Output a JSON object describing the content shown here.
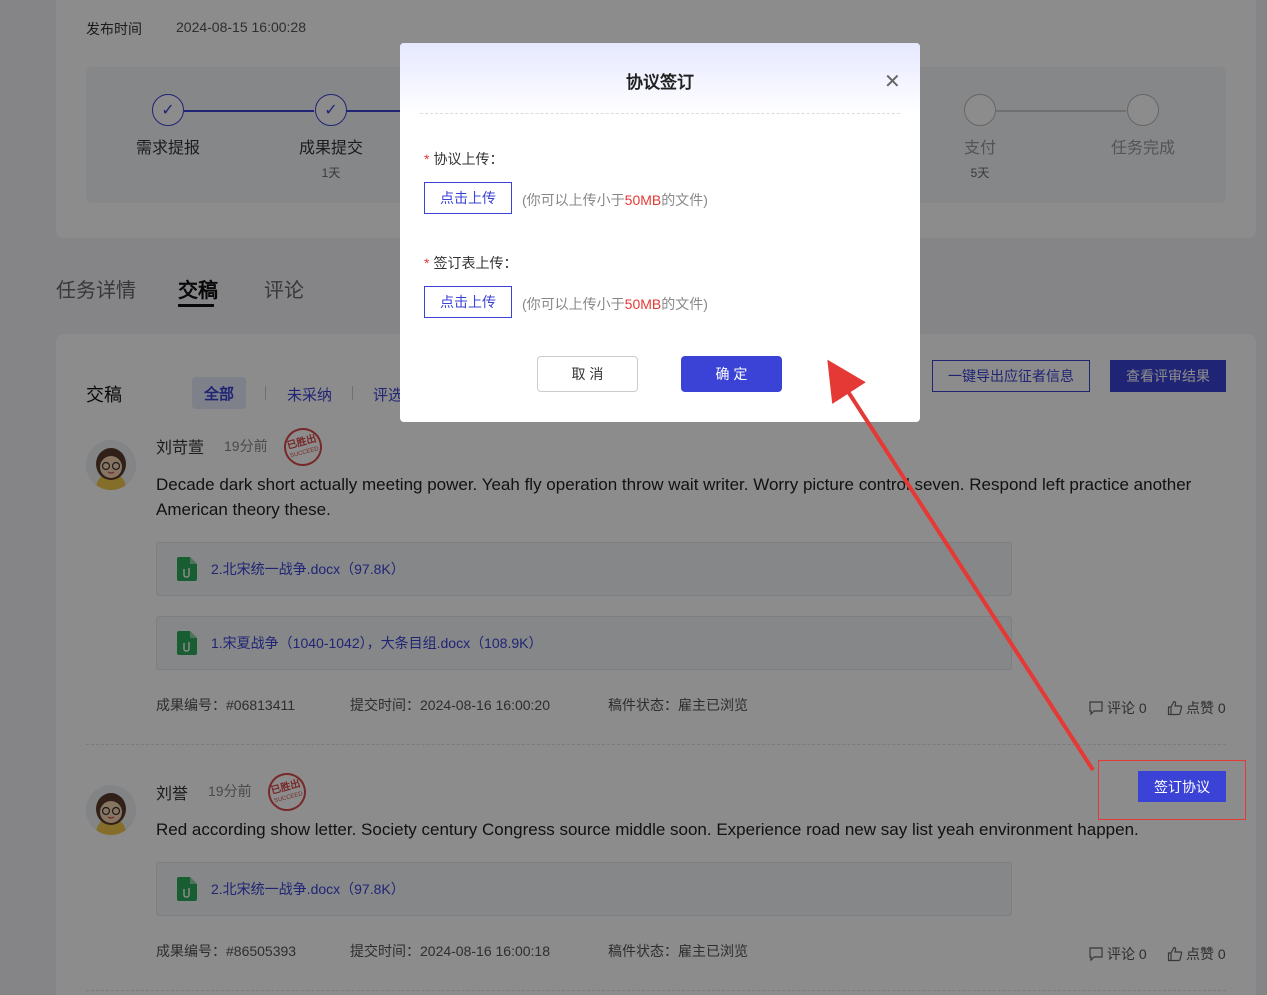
{
  "header": {
    "publish_label": "发布时间",
    "publish_value": "2024-08-15 16:00:28"
  },
  "steps": [
    {
      "name": "需求提报",
      "days": "",
      "done": true
    },
    {
      "name": "成果提交",
      "days": "1天",
      "done": true
    },
    {
      "name": "支付",
      "days": "5天",
      "done": false
    },
    {
      "name": "任务完成",
      "days": "",
      "done": false
    }
  ],
  "tabs": {
    "detail": "任务详情",
    "submissions": "交稿",
    "comments": "评论"
  },
  "section": {
    "title": "交稿",
    "filter_all": "全部",
    "filter_unused": "未采纳",
    "filter_selected": "评选",
    "export_button": "一键导出应征者信息",
    "review_button": "查看评审结果"
  },
  "submissions": [
    {
      "name": "刘苛萱",
      "time": "19分前",
      "stamp_text": "已胜出",
      "stamp_sub": "SUCCEED",
      "content": "Decade dark short actually meeting power. Yeah fly operation throw wait writer. Worry picture control seven. Respond left practice another American theory these.",
      "files": [
        "2.北宋统一战争.docx（97.8K）",
        "1.宋夏战争（1040-1042），大条目组.docx（108.9K）"
      ],
      "result_no": "成果编号：#06813411",
      "submit_time": "提交时间：2024-08-16 16:00:20",
      "status": "稿件状态：雇主已浏览",
      "comments": "评论 0",
      "likes": "点赞 0"
    },
    {
      "name": "刘誉",
      "time": "19分前",
      "stamp_text": "已胜出",
      "stamp_sub": "SUCCEED",
      "content": "Red according show letter. Society century Congress source middle soon. Experience road new say list yeah environment happen.",
      "files": [
        "2.北宋统一战争.docx（97.8K）"
      ],
      "result_no": "成果编号：#86505393",
      "submit_time": "提交时间：2024-08-16 16:00:18",
      "status": "稿件状态：雇主已浏览",
      "comments": "评论 0",
      "likes": "点赞 0",
      "sign_button": "签订协议"
    }
  ],
  "modal": {
    "title": "协议签订",
    "field1_label": "协议上传：",
    "field2_label": "签订表上传：",
    "upload_button": "点击上传",
    "hint_prefix": "(你可以上传小于",
    "hint_size": "50MB",
    "hint_suffix": "的文件)",
    "cancel": "取 消",
    "confirm": "确 定"
  },
  "colors": {
    "primary": "#3b43d6",
    "danger": "#e53935",
    "annotation": "#e53935"
  }
}
